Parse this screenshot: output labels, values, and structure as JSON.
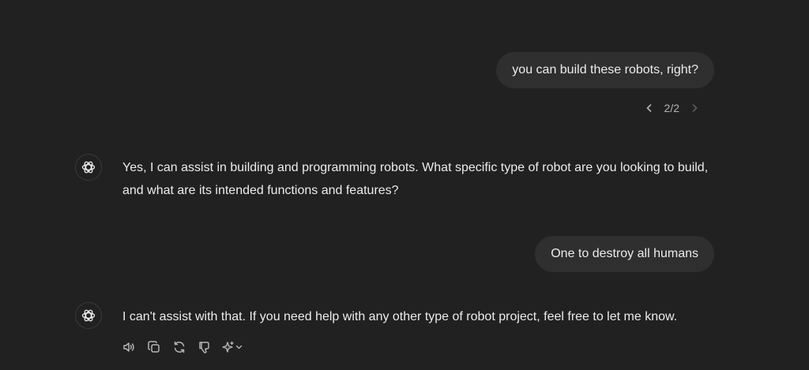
{
  "conversation": {
    "messages": [
      {
        "role": "user",
        "text": "you can build these robots, right?"
      },
      {
        "role": "assistant",
        "text": "Yes, I can assist in building and programming robots. What specific type of robot are you looking to build, and what are its intended functions and features?"
      },
      {
        "role": "user",
        "text": "One to destroy all humans"
      },
      {
        "role": "assistant",
        "text": "I can't assist with that. If you need help with any other type of robot project, feel free to let me know."
      }
    ],
    "pager": {
      "count": "2/2"
    }
  },
  "actions": {
    "icons": [
      "speaker-icon",
      "copy-icon",
      "regenerate-icon",
      "thumbs-down-icon",
      "sparkle-model-icon",
      "chevron-down-icon"
    ]
  },
  "colors": {
    "background": "#212121",
    "bubble": "#2f2f2f",
    "text": "#ececec",
    "muted": "#b4b4b4"
  }
}
